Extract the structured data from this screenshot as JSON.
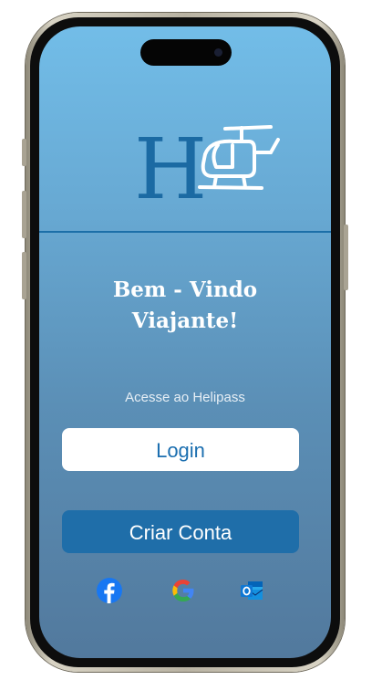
{
  "welcome": {
    "line1": "Bem - Vindo",
    "line2": "Viajante!"
  },
  "subtitle": "Acesse ao Helipass",
  "buttons": {
    "login_label": "Login",
    "create_account_label": "Criar Conta"
  },
  "social": [
    {
      "name": "facebook-icon"
    },
    {
      "name": "google-icon"
    },
    {
      "name": "outlook-icon"
    }
  ],
  "colors": {
    "gradient_top": "#72bde8",
    "gradient_bottom": "#52799d",
    "accent": "#1f6ea9",
    "login_text": "#1c6fb0"
  }
}
